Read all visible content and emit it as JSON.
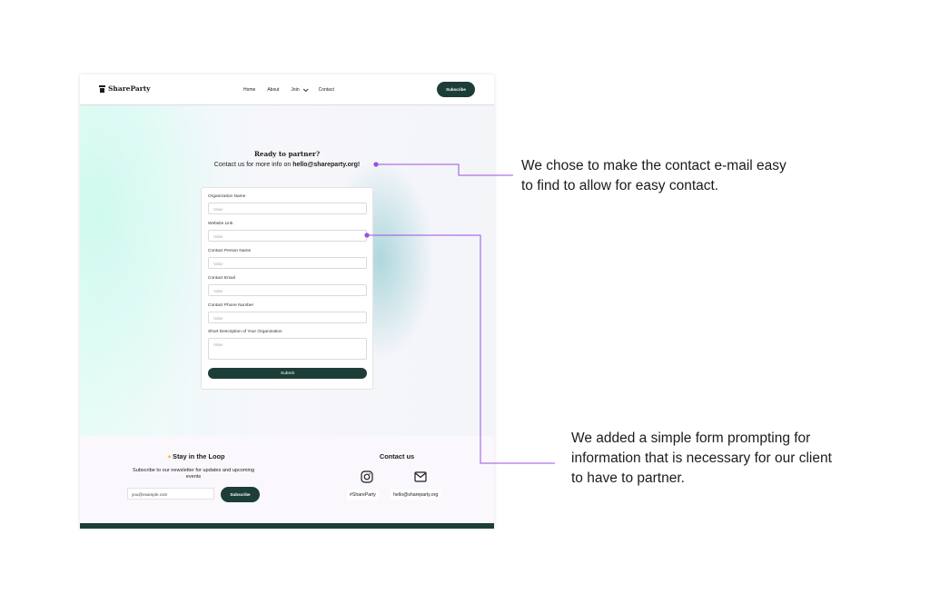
{
  "site": {
    "logo_text": "ShareParty",
    "nav": {
      "links": [
        "Home",
        "About",
        "Join",
        "Contact"
      ],
      "subscribe_label": "Subscribe"
    }
  },
  "hero": {
    "title": "Ready to partner?",
    "subtitle_prefix": "Contact us for more info on ",
    "subtitle_email": "hello@shareparty.org!"
  },
  "form": {
    "fields": [
      {
        "label": "Organization Name",
        "placeholder": "Value"
      },
      {
        "label": "Website Link",
        "placeholder": "Value"
      },
      {
        "label": "Contact Person Name",
        "placeholder": "Value"
      },
      {
        "label": "Contact Email",
        "placeholder": "Value"
      },
      {
        "label": "Contact Phone Number",
        "placeholder": "Value"
      },
      {
        "label": "Short Description of Your Organization",
        "placeholder": "Value"
      }
    ],
    "submit_label": "Submit"
  },
  "footer": {
    "stay_title": "Stay in the Loop",
    "stay_desc": "Subscribe to our newsletter for updates and upcoming events",
    "email_value": "you@example.com",
    "subscribe_label": "Subscribe",
    "contact_title": "Contact us",
    "instagram_tag": "#ShareParty",
    "email_tag": "hello@shareparty.org"
  },
  "annotations": [
    {
      "text": "We chose to make the contact e-mail easy to find to allow for easy contact."
    },
    {
      "text": "We added a simple form prompting for information that is necessary for our client to have to partner."
    }
  ],
  "colors": {
    "brand_dark_green": "#1d3e38",
    "annotation_purple": "#9b4fe3",
    "accent_yellow": "#f2b54a"
  }
}
